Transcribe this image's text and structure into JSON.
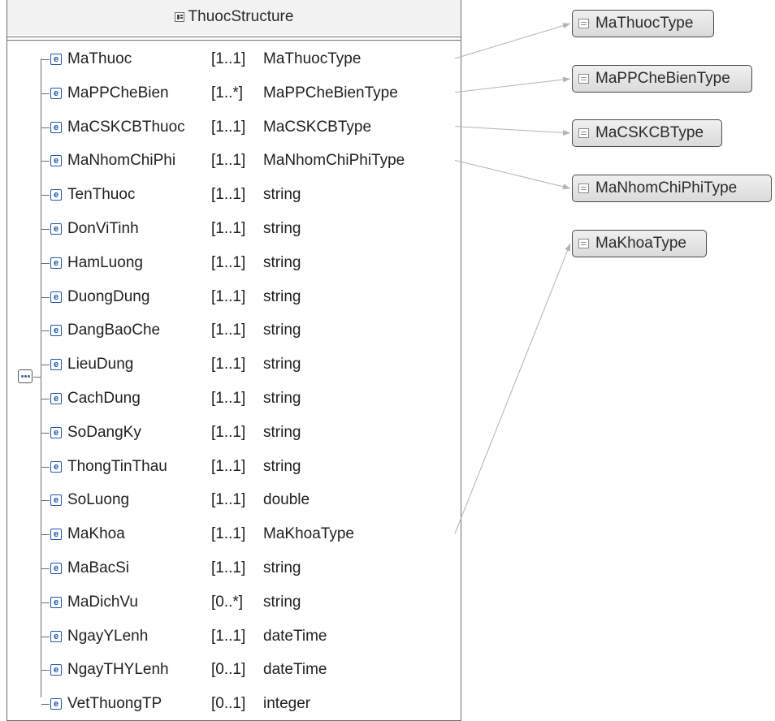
{
  "structure": {
    "title": "ThuocStructure",
    "elements": [
      {
        "name": "MaThuoc",
        "cardinality": "[1..1]",
        "type": "MaThuocType"
      },
      {
        "name": "MaPPCheBien",
        "cardinality": "[1..*]",
        "type": "MaPPCheBienType"
      },
      {
        "name": "MaCSKCBThuoc",
        "cardinality": "[1..1]",
        "type": "MaCSKCBType"
      },
      {
        "name": "MaNhomChiPhi",
        "cardinality": "[1..1]",
        "type": "MaNhomChiPhiType"
      },
      {
        "name": "TenThuoc",
        "cardinality": "[1..1]",
        "type": "string"
      },
      {
        "name": "DonViTinh",
        "cardinality": "[1..1]",
        "type": "string"
      },
      {
        "name": "HamLuong",
        "cardinality": "[1..1]",
        "type": "string"
      },
      {
        "name": "DuongDung",
        "cardinality": "[1..1]",
        "type": "string"
      },
      {
        "name": "DangBaoChe",
        "cardinality": "[1..1]",
        "type": "string"
      },
      {
        "name": "LieuDung",
        "cardinality": "[1..1]",
        "type": "string"
      },
      {
        "name": "CachDung",
        "cardinality": "[1..1]",
        "type": "string"
      },
      {
        "name": "SoDangKy",
        "cardinality": "[1..1]",
        "type": "string"
      },
      {
        "name": "ThongTinThau",
        "cardinality": "[1..1]",
        "type": "string"
      },
      {
        "name": "SoLuong",
        "cardinality": "[1..1]",
        "type": "double"
      },
      {
        "name": "MaKhoa",
        "cardinality": "[1..1]",
        "type": "MaKhoaType"
      },
      {
        "name": "MaBacSi",
        "cardinality": "[1..1]",
        "type": "string"
      },
      {
        "name": "MaDichVu",
        "cardinality": "[0..*]",
        "type": "string"
      },
      {
        "name": "NgayYLenh",
        "cardinality": "[1..1]",
        "type": "dateTime"
      },
      {
        "name": "NgayTHYLenh",
        "cardinality": "[0..1]",
        "type": "dateTime"
      },
      {
        "name": "VetThuongTP",
        "cardinality": "[0..1]",
        "type": "integer"
      }
    ]
  },
  "element_icon_letter": "e",
  "simple_types": [
    "MaThuocType",
    "MaPPCheBienType",
    "MaCSKCBType",
    "MaNhomChiPhiType",
    "MaKhoaType"
  ],
  "colors": {
    "element_icon": "#1e56a8",
    "connector": "#b3b3b3",
    "type_box": "#dadada"
  },
  "icons": {
    "structure": "complex-type-icon",
    "sequence": "sequence-icon",
    "element": "element-icon",
    "simple_type": "simple-type-icon"
  }
}
